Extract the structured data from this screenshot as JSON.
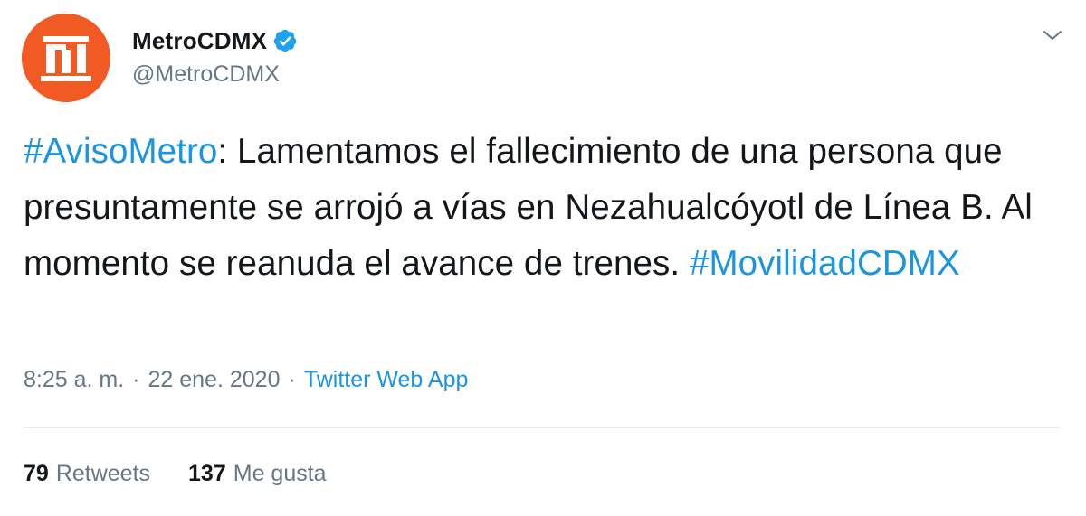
{
  "author": {
    "display_name": "MetroCDMX",
    "handle": "@MetroCDMX",
    "verified": true,
    "avatar_icon": "metro-cdmx-logo",
    "avatar_color": "#f15a22"
  },
  "tweet": {
    "hashtag_1": "#AvisoMetro",
    "text": ": Lamentamos el fallecimiento de una persona que presuntamente se arrojó a vías en Nezahualcóyotl de Línea B. Al momento se reanuda el avance de trenes. ",
    "hashtag_2": "#MovilidadCDMX"
  },
  "meta": {
    "time": "8:25 a. m.",
    "separator": "·",
    "date": "22 ene. 2020",
    "source": "Twitter Web App"
  },
  "stats": {
    "retweets_count": "79",
    "retweets_label": "Retweets",
    "likes_count": "137",
    "likes_label": "Me gusta"
  },
  "colors": {
    "link": "#1b95e0",
    "secondary_text": "#657786",
    "verified": "#1da1f2"
  },
  "icons": {
    "menu": "chevron-down-icon",
    "verified": "verified-badge-icon"
  }
}
